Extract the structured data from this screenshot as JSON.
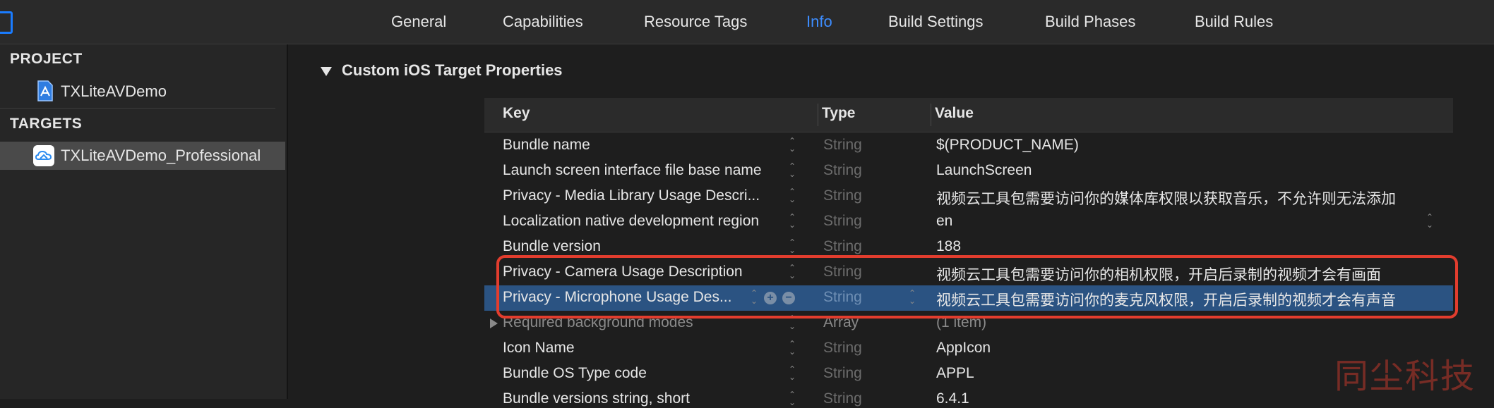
{
  "tabs": [
    {
      "label": "General",
      "active": false
    },
    {
      "label": "Capabilities",
      "active": false
    },
    {
      "label": "Resource Tags",
      "active": false
    },
    {
      "label": "Info",
      "active": true
    },
    {
      "label": "Build Settings",
      "active": false
    },
    {
      "label": "Build Phases",
      "active": false
    },
    {
      "label": "Build Rules",
      "active": false
    }
  ],
  "sidebar": {
    "project_header": "PROJECT",
    "project_item": "TXLiteAVDemo",
    "targets_header": "TARGETS",
    "target_item": "TXLiteAVDemo_Professional"
  },
  "main": {
    "section_title": "Custom iOS Target Properties",
    "columns": {
      "key": "Key",
      "type": "Type",
      "value": "Value"
    },
    "rows": [
      {
        "key": "Bundle name",
        "type": "String",
        "value": "$(PRODUCT_NAME)"
      },
      {
        "key": "Launch screen interface file base name",
        "type": "String",
        "value": "LaunchScreen"
      },
      {
        "key": "Privacy - Media Library Usage Descri...",
        "type": "String",
        "value": "视频云工具包需要访问你的媒体库权限以获取音乐，不允许则无法添加"
      },
      {
        "key": "Localization native development region",
        "type": "String",
        "value": "en"
      },
      {
        "key": "Bundle version",
        "type": "String",
        "value": "188"
      },
      {
        "key": "Privacy - Camera Usage Description",
        "type": "String",
        "value": "视频云工具包需要访问你的相机权限，开启后录制的视频才会有画面"
      },
      {
        "key": "Privacy - Microphone Usage Des...",
        "type": "String",
        "value": "视频云工具包需要访问你的麦克风权限，开启后录制的视频才会有声音"
      },
      {
        "key": "Required background modes",
        "type": "Array",
        "value": "(1 item)"
      },
      {
        "key": "Icon Name",
        "type": "String",
        "value": "AppIcon"
      },
      {
        "key": "Bundle OS Type code",
        "type": "String",
        "value": "APPL"
      },
      {
        "key": "Bundle versions string, short",
        "type": "String",
        "value": "6.4.1"
      }
    ]
  },
  "watermark": "同尘科技",
  "colors": {
    "accent": "#3d8dff",
    "selection": "#2b5382",
    "highlight": "#e23d2e"
  }
}
